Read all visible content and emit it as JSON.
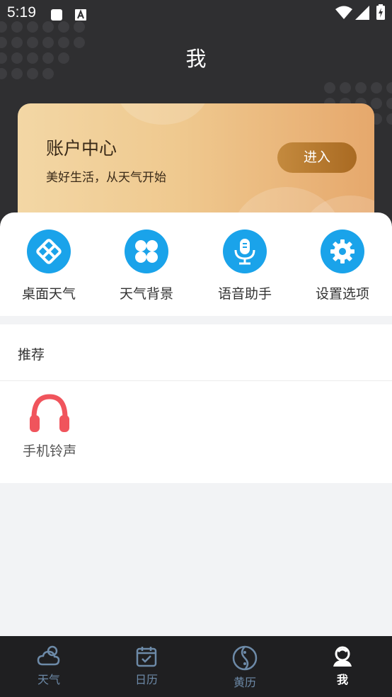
{
  "status_bar": {
    "time": "5:19"
  },
  "page": {
    "title": "我"
  },
  "account": {
    "title": "账户中心",
    "subtitle": "美好生活，从天气开始",
    "enter_label": "进入"
  },
  "tools": [
    {
      "label": "桌面天气",
      "icon": "widget-icon"
    },
    {
      "label": "天气背景",
      "icon": "grid-clover-icon"
    },
    {
      "label": "语音助手",
      "icon": "microphone-icon"
    },
    {
      "label": "设置选项",
      "icon": "gear-icon"
    }
  ],
  "recommend": {
    "title": "推荐",
    "items": [
      {
        "label": "手机铃声",
        "icon": "headphones-icon"
      }
    ]
  },
  "bottom_nav": [
    {
      "label": "天气",
      "icon": "cloud-icon",
      "active": false
    },
    {
      "label": "日历",
      "icon": "calendar-icon",
      "active": false
    },
    {
      "label": "黄历",
      "icon": "yin-yang-icon",
      "active": false
    },
    {
      "label": "我",
      "icon": "person-icon",
      "active": true
    }
  ],
  "colors": {
    "header_bg": "#2f2f31",
    "tool_icon_bg": "#1aa3ea",
    "ringtone_red": "#f0545c",
    "nav_bg": "#1f1f21",
    "nav_inactive": "#6d8aa8",
    "nav_active": "#ffffff"
  }
}
